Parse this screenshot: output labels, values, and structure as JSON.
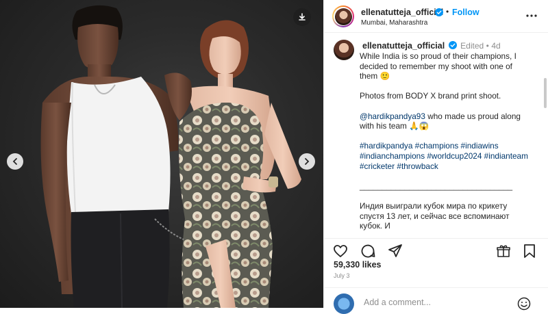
{
  "post": {
    "author": "ellenatutteja_official",
    "follow_label": "Follow",
    "separator": "•",
    "location": "Mumbai, Maharashtra"
  },
  "caption": {
    "author": "ellenatutteja_official",
    "edited": "Edited",
    "dot": "•",
    "age": "4d",
    "line1": "While India is so proud of their champions, I decided to remember my shoot with one of them 🙂",
    "line2": "Photos from BODY X brand print shoot.",
    "mention": "@hardikpandya93",
    "line3_rest": " who made us proud along with his team 🙏😱",
    "hashtags": "#hardikpandya #champions #indiawins #indianchampions #worldcup2024 #indianteam #cricketer #throwback",
    "divider": "__________________________________",
    "russian": "Индия выиграли кубок мира по крикету спустя 13 лет, и сейчас все вспоминают кубок. И"
  },
  "stats": {
    "likes": "59,330 likes",
    "date": "July 3"
  },
  "comment_box": {
    "placeholder": "Add a comment..."
  },
  "icons": {
    "download": "download-icon",
    "prev": "chevron-left-icon",
    "next": "chevron-right-icon",
    "more": "more-horizontal-icon",
    "verified": "verified-badge-icon",
    "like": "heart-icon",
    "comment": "comment-icon",
    "share": "send-icon",
    "save": "bookmark-icon",
    "gift": "gift-icon",
    "emoji": "emoji-icon"
  },
  "colors": {
    "accent": "#0095f6",
    "link": "#00376b",
    "muted": "#8e8e8e"
  }
}
